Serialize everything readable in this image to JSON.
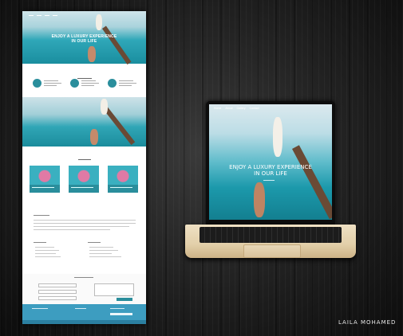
{
  "mockup_page": {
    "hero_headline_line1": "ENJOY A LUXURY EXPERIENCE",
    "hero_headline_line2": "IN OUR LIFE"
  },
  "laptop_screen": {
    "nav": [
      "Home",
      "About",
      "Gallery",
      "Contact"
    ],
    "headline_line1": "ENJOY A LUXURY EXPERIENCE",
    "headline_line2": "IN OUR LIFE"
  },
  "signature": "LAILA MOHAMED",
  "colors": {
    "background": "#161616",
    "accent_teal": "#2a8e9c",
    "footer_blue": "#3d9dc0",
    "laptop_gold": "#e2cfa9"
  }
}
